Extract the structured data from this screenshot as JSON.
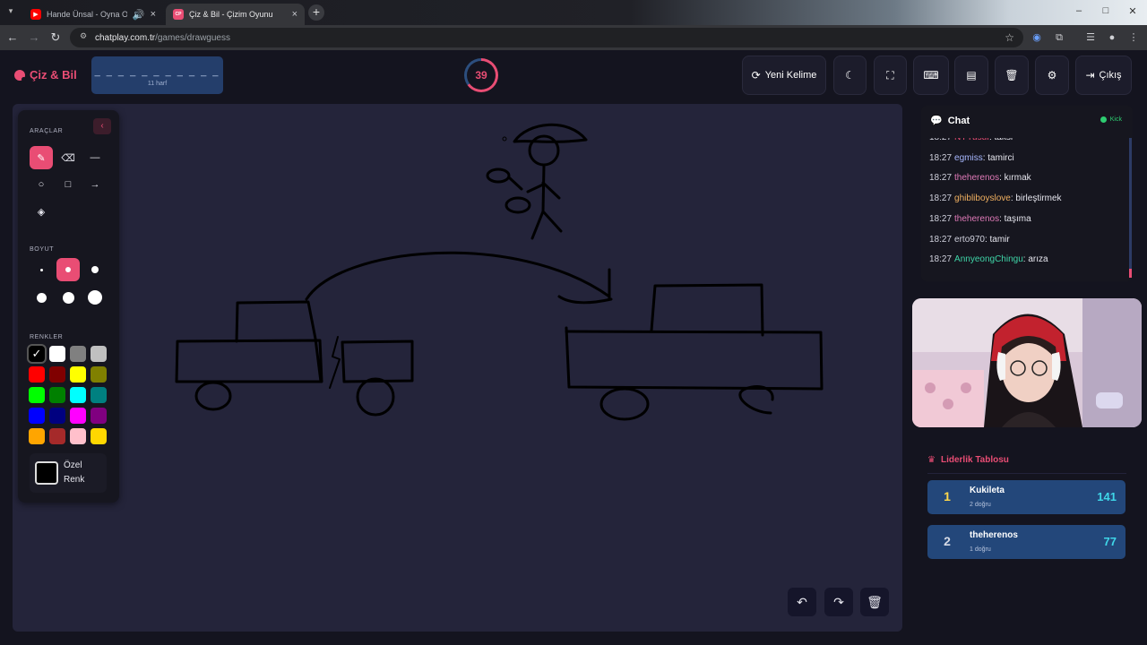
{
  "browser": {
    "tabs": [
      {
        "title": "Hande Ünsal - Oyna Oyna",
        "active": false
      },
      {
        "title": "Çiz & Bil - Çizim Oyunu",
        "favicon_text": "CP",
        "active": true
      }
    ],
    "url_host": "chatplay.com.tr",
    "url_path": "/games/drawguess"
  },
  "header": {
    "logo_text": "Çiz & Bil",
    "word_mask": "_ _ _ _ _ _ _ _ _ _ _",
    "word_hint": "11 harf",
    "timer_value": "39",
    "timer_fraction": 0.65,
    "buttons": {
      "new_word": "Yeni Kelime",
      "exit": "Çıkış"
    }
  },
  "tools": {
    "tools_title": "ARAÇLAR",
    "size_title": "BOYUT",
    "colors_title": "RENKLER",
    "custom_color_line1": "Özel",
    "custom_color_line2": "Renk",
    "selected_tool": "brush",
    "selected_size_index": 1,
    "selected_color_index": 0,
    "colors": [
      "#000000",
      "#ffffff",
      "#808080",
      "#c0c0c0",
      "#ff0000",
      "#800000",
      "#ffff00",
      "#808000",
      "#00ff00",
      "#008000",
      "#00ffff",
      "#008080",
      "#0000ff",
      "#000080",
      "#ff00ff",
      "#800080",
      "#ffa500",
      "#a52a2a",
      "#ffc0cb",
      "#ffd700"
    ]
  },
  "chat": {
    "title": "Chat",
    "platform": "Kick",
    "messages": [
      {
        "time": "18:27",
        "user": "NYYusuf",
        "user_color": "#e94d74",
        "text": "taksi"
      },
      {
        "time": "18:27",
        "user": "egmiss",
        "user_color": "#a8b8ff",
        "text": "tamirci"
      },
      {
        "time": "18:27",
        "user": "theherenos",
        "user_color": "#e07ab8",
        "text": "kırmak"
      },
      {
        "time": "18:27",
        "user": "ghibliboyslove",
        "user_color": "#f0b060",
        "text": "birleştirmek"
      },
      {
        "time": "18:27",
        "user": "theherenos",
        "user_color": "#e07ab8",
        "text": "taşıma"
      },
      {
        "time": "18:27",
        "user": "erto970",
        "user_color": "#cfd0dc",
        "text": "tamir"
      },
      {
        "time": "18:27",
        "user": "AnnyeongChingu",
        "user_color": "#3fd6a8",
        "text": "arıza"
      }
    ]
  },
  "leaderboard": {
    "title": "Liderlik Tablosu",
    "rows": [
      {
        "rank": "1",
        "rank_color": "#ffd84a",
        "name": "Kukileta",
        "sub": "2 doğru",
        "score": "141"
      },
      {
        "rank": "2",
        "rank_color": "#d6dbe6",
        "name": "theherenos",
        "sub": "1 doğru",
        "score": "77"
      }
    ]
  },
  "theme": {
    "accent": "#e94d74",
    "panel": "#16161f",
    "canvas": "#24243a",
    "row": "#23477a"
  }
}
